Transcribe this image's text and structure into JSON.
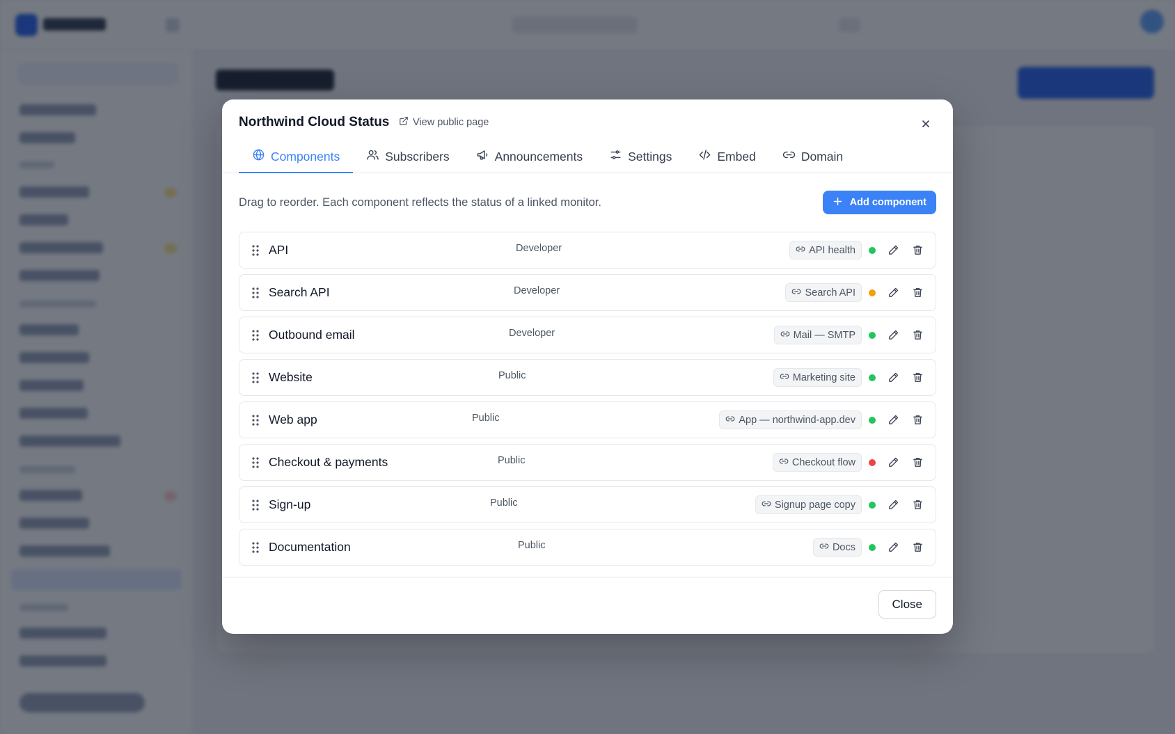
{
  "colors": {
    "accent": "#3b82f6",
    "status_operational": "#22c55e",
    "status_degraded": "#f59e0b",
    "status_down": "#ef4444"
  },
  "modal": {
    "title": "Northwind Cloud Status",
    "public_link": {
      "label": "View public page",
      "icon": "external-link-icon"
    },
    "close_icon": "close-icon",
    "tabs": [
      {
        "label": "Components",
        "icon": "globe-icon",
        "active": true
      },
      {
        "label": "Subscribers",
        "icon": "users-icon",
        "active": false
      },
      {
        "label": "Announcements",
        "icon": "megaphone-icon",
        "active": false
      },
      {
        "label": "Settings",
        "icon": "sliders-icon",
        "active": false
      },
      {
        "label": "Embed",
        "icon": "code-icon",
        "active": false
      },
      {
        "label": "Domain",
        "icon": "link-icon",
        "active": false
      }
    ],
    "hint": "Drag to reorder. Each component reflects the status of a linked monitor.",
    "add_button": "Add component",
    "components": [
      {
        "name": "API",
        "group": "Developer",
        "monitor": "API health",
        "status": "operational"
      },
      {
        "name": "Search API",
        "group": "Developer",
        "monitor": "Search API",
        "status": "degraded"
      },
      {
        "name": "Outbound email",
        "group": "Developer",
        "monitor": "Mail — SMTP",
        "status": "operational"
      },
      {
        "name": "Website",
        "group": "Public",
        "monitor": "Marketing site",
        "status": "operational"
      },
      {
        "name": "Web app",
        "group": "Public",
        "monitor": "App — northwind-app.dev",
        "status": "operational"
      },
      {
        "name": "Checkout & payments",
        "group": "Public",
        "monitor": "Checkout flow",
        "status": "down"
      },
      {
        "name": "Sign-up",
        "group": "Public",
        "monitor": "Signup page copy",
        "status": "operational"
      },
      {
        "name": "Documentation",
        "group": "Public",
        "monitor": "Docs",
        "status": "operational"
      }
    ],
    "close_button": "Close"
  }
}
